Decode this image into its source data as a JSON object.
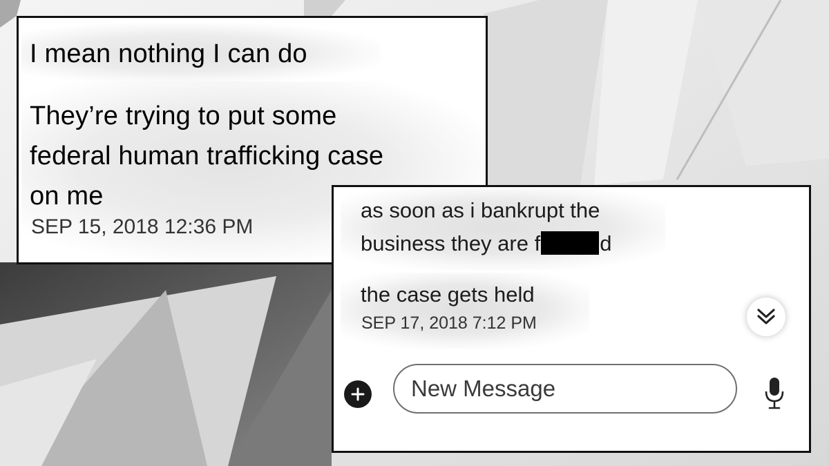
{
  "conversation_top": {
    "messages": [
      {
        "text_lines": [
          "I mean nothing I can do"
        ]
      },
      {
        "text_lines": [
          "They’re trying to put some",
          "federal human trafficking case",
          "on me"
        ]
      }
    ],
    "timestamp": "SEP 15, 2018 12:36 PM"
  },
  "conversation_bottom": {
    "messages": [
      {
        "line1": "as soon as i bankrupt the",
        "line2_before": "business they are f",
        "line2_after": "d"
      },
      {
        "text": "the case gets held"
      }
    ],
    "timestamp": "SEP 17, 2018 7:12 PM",
    "composer": {
      "placeholder": "New Message",
      "add_icon": "plus-circle-icon",
      "mic_icon": "microphone-icon",
      "scroll_icon": "double-chevron-down-icon"
    }
  }
}
